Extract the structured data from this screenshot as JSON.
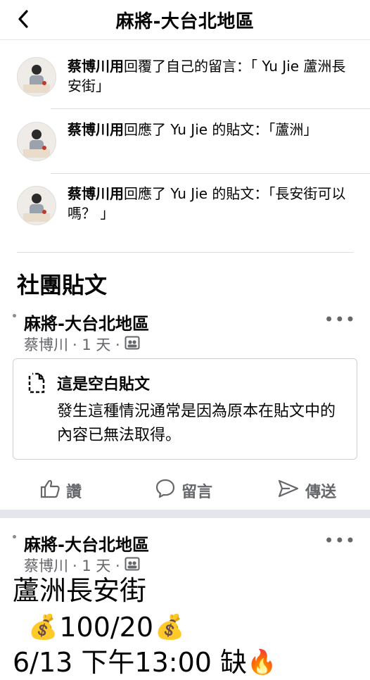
{
  "header": {
    "title": "麻將-大台北地區"
  },
  "notifications": [
    {
      "name": "蔡博川用",
      "text": "回覆了自己的留言：「 Yu Jie 蘆洲長安街」"
    },
    {
      "name": "蔡博川用",
      "text": "回應了 Yu Jie 的貼文：「蘆洲」"
    },
    {
      "name": "蔡博川用",
      "text": "回應了 Yu Jie 的貼文：「長安街可以嗎？ 」"
    }
  ],
  "section": {
    "title": "社團貼文"
  },
  "posts": [
    {
      "group": "麻將-大台北地區",
      "author": "蔡博川",
      "time": "· 1 天 ·",
      "empty_title": "這是空白貼文",
      "empty_body": "發生這種情況通常是因為原本在貼文中的內容已無法取得。",
      "actions": {
        "like": "讚",
        "comment": "留言",
        "share": "傳送"
      }
    },
    {
      "group": "麻將-大台北地區",
      "author": "蔡博川",
      "time": "· 1 天 ·",
      "line1": "蘆洲長安街",
      "line2": "100/20",
      "line3": "6/13 下午13:00 缺"
    }
  ],
  "icons": {
    "back": "chevron-left-icon",
    "more": "more-horizontal-icon",
    "audience": "group-audience-icon",
    "empty_post": "document-icon",
    "like": "thumbs-up-icon",
    "comment": "comment-icon",
    "share": "send-icon",
    "money": "money-bag-icon",
    "fire": "fire-icon"
  },
  "colors": {
    "secondary_text": "#65676b",
    "divider": "#dadde1",
    "band": "#e4e6eb"
  }
}
